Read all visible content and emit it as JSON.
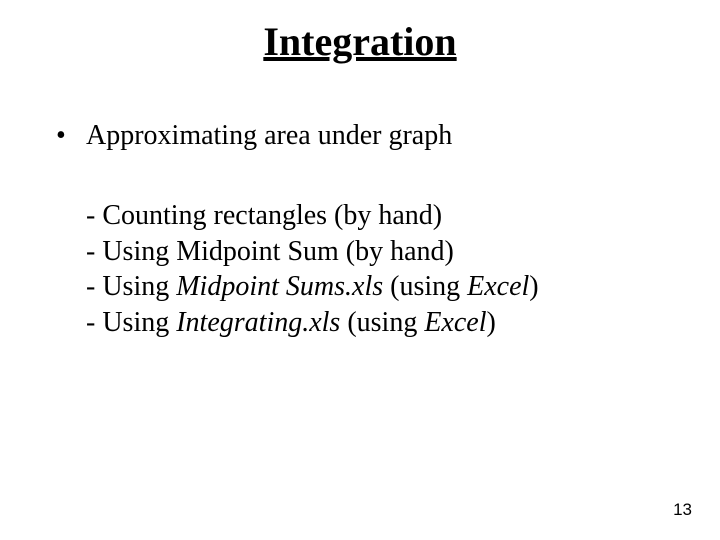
{
  "title": "Integration",
  "bullet": {
    "dot": "•",
    "text": "Approximating area under graph"
  },
  "subitems": [
    {
      "prefix": "- Counting rectangles (by hand)"
    },
    {
      "prefix": "- Using Midpoint Sum (by hand)"
    },
    {
      "prefix": "- Using ",
      "italic1": "Midpoint Sums.xls",
      "mid": " (using ",
      "italic2": "Excel",
      "suffix": ")"
    },
    {
      "prefix": "- Using ",
      "italic1": "Integrating.xls",
      "mid": " (using ",
      "italic2": "Excel",
      "suffix": ")"
    }
  ],
  "page_number": "13"
}
